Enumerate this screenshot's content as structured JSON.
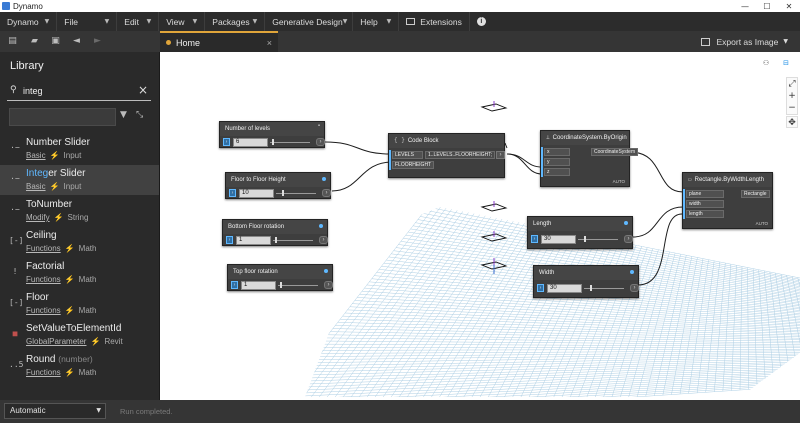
{
  "window": {
    "title": "Dynamo",
    "minimize": "—",
    "maximize": "☐",
    "close": "✕"
  },
  "menu": {
    "items": [
      "Dynamo",
      "File",
      "Edit",
      "View",
      "Packages",
      "Generative Design",
      "Help"
    ],
    "extensions": "Extensions",
    "help_icon": "i"
  },
  "tab": {
    "label": "Home",
    "close": "×"
  },
  "export": {
    "label": "Export as Image"
  },
  "library": {
    "title": "Library",
    "search_value": "integ",
    "items": [
      {
        "name": "Number Slider",
        "category": "Basic",
        "subcategory": "Input",
        "icon": "·−"
      },
      {
        "name_pre": "",
        "name_hl": "Integ",
        "name_post": "er Slider",
        "category": "Basic",
        "subcategory": "Input",
        "icon": "·−",
        "selected": true
      },
      {
        "name": "ToNumber",
        "category": "Modify",
        "subcategory": "String",
        "icon": "·−"
      },
      {
        "name": "Ceiling",
        "category": "Functions",
        "subcategory": "Math",
        "icon": "[-]"
      },
      {
        "name": "Factorial",
        "category": "Functions",
        "subcategory": "Math",
        "icon": "!"
      },
      {
        "name": "Floor",
        "category": "Functions",
        "subcategory": "Math",
        "icon": "[-]"
      },
      {
        "name": "SetValueToElementId",
        "category": "GlobalParameter",
        "subcategory": "Revit",
        "icon": "■"
      },
      {
        "name": "Round",
        "hint": "(number)",
        "category": "Functions",
        "subcategory": "Math",
        "icon": "..5"
      }
    ]
  },
  "status": {
    "run_mode": "Automatic",
    "message": "Run completed."
  },
  "nodes": {
    "levels": {
      "title": "Number of levels",
      "value": "6"
    },
    "floor_height": {
      "title": "Floor to Floor Height",
      "value": "10"
    },
    "bottom_rot": {
      "title": "Bottom Floor rotation",
      "value": "1"
    },
    "top_rot": {
      "title": "Top floor rotation",
      "value": "1"
    },
    "code_block": {
      "title": "Code Block",
      "port1": "LEVELS",
      "port2": "FLOORHEIGHT",
      "code": "1..LEVELS..FLOORHEIGHT;"
    },
    "coord": {
      "title": "CoordinateSystem.ByOrigin",
      "ports": [
        "x",
        "y",
        "z"
      ],
      "output": "CoordinateSystem",
      "lacing": "AUTO"
    },
    "length": {
      "title": "Length",
      "value": "30"
    },
    "width": {
      "title": "Width",
      "value": "30"
    },
    "rect": {
      "title": "Rectangle.ByWidthLength",
      "ports": [
        "plane",
        "width",
        "length"
      ],
      "output": "Rectangle",
      "lacing": "AUTO"
    }
  },
  "colors": {
    "accent": "#e0a53a",
    "highlight": "#5fb8ff",
    "node_bg": "#3e3e3e",
    "canvas": "#ffffff",
    "grid": "#9ec6e0"
  }
}
